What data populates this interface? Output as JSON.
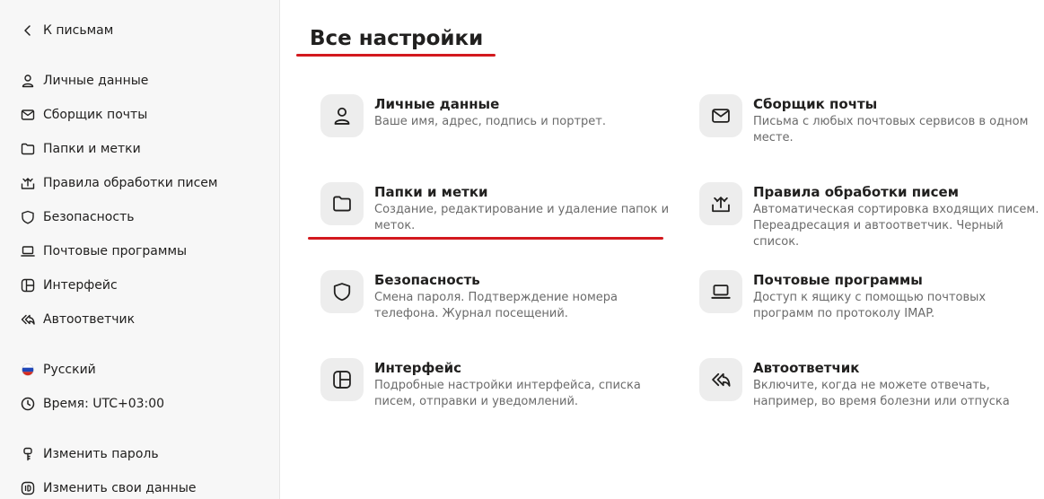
{
  "sidebar": {
    "back_label": "К письмам",
    "items": [
      {
        "label": "Личные данные",
        "icon": "user-icon"
      },
      {
        "label": "Сборщик почты",
        "icon": "envelope-icon"
      },
      {
        "label": "Папки и метки",
        "icon": "folder-icon"
      },
      {
        "label": "Правила обработки писем",
        "icon": "rules-icon"
      },
      {
        "label": "Безопасность",
        "icon": "shield-icon"
      },
      {
        "label": "Почтовые программы",
        "icon": "laptop-icon"
      },
      {
        "label": "Интерфейс",
        "icon": "layout-icon"
      },
      {
        "label": "Автоответчик",
        "icon": "reply-all-icon"
      }
    ],
    "language": "Русский",
    "timezone": "Время: UTC+03:00",
    "change_password": "Изменить пароль",
    "change_data": "Изменить свои данные"
  },
  "main": {
    "title": "Все настройки",
    "cards": [
      {
        "title": "Личные данные",
        "desc": "Ваше имя, адрес, подпись и портрет.",
        "icon": "user-icon"
      },
      {
        "title": "Сборщик почты",
        "desc": "Письма с любых почтовых сервисов в одном месте.",
        "icon": "envelope-icon"
      },
      {
        "title": "Папки и метки",
        "desc": "Создание, редактирование и удаление папок и меток.",
        "icon": "folder-icon"
      },
      {
        "title": "Правила обработки писем",
        "desc": "Автоматическая сортировка входящих писем. Переадресация и автоответчик. Черный список.",
        "icon": "rules-icon"
      },
      {
        "title": "Безопасность",
        "desc": "Смена пароля. Подтверждение номера телефона. Журнал посещений.",
        "icon": "shield-icon"
      },
      {
        "title": "Почтовые программы",
        "desc": "Доступ к ящику с помощью почтовых программ по протоколу IMAP.",
        "icon": "laptop-icon"
      },
      {
        "title": "Интерфейс",
        "desc": "Подробные настройки интерфейса, списка писем, отправки и уведомлений.",
        "icon": "layout-icon"
      },
      {
        "title": "Автоответчик",
        "desc": "Включите, когда не можете отвечать, например, во время болезни или отпуска",
        "icon": "reply-all-icon"
      }
    ]
  },
  "colors": {
    "annotation_red": "#d3191e",
    "tile_bg": "#ededed",
    "sidebar_bg": "#f7f7f7"
  }
}
